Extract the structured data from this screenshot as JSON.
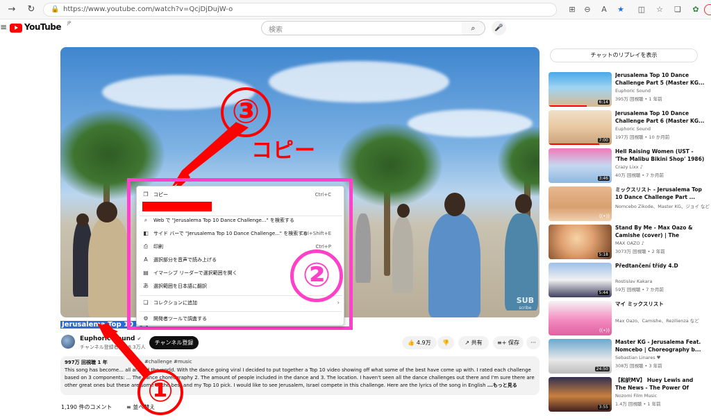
{
  "browser": {
    "url": "https://www.youtube.com/watch?v=QcjDjDujW-o"
  },
  "youtube": {
    "logo_text": "YouTube",
    "region": "JP",
    "search_placeholder": "検索"
  },
  "video": {
    "title": "Jerusalema Top 10 Da",
    "watermark_main": "SUB",
    "watermark_sub": "scribe",
    "channel_name": "Euphoric Sound",
    "channel_subs": "チャンネル登録者数 28.3万人",
    "subscribe_label": "チャンネル登録",
    "likes": "4.9万",
    "share_label": "共有",
    "save_label": "保存",
    "more_label": "···"
  },
  "description": {
    "meta": "997万 回視聴 1 年",
    "tags": "#challenge #music",
    "body": "This song has become... all around the world. With the dance going viral I decided to put together a Top 10 video showing off what some of the best have come up with. I rated each challenge based on 3 components: ... The dance choreography 2. The amount of people included in the dance and 3. The location. I haven't seen all the dance challenges out there and I'm sure there are other great ones but these are some of the best and my Top 10 pick. I would like to see Jerusalem, Israel compete in this challenge. Here are the lyrics of the song in English",
    "more": "...もっと見る"
  },
  "comments": {
    "count": "1,190 件のコメント",
    "sort": "並べ替え"
  },
  "context_menu": {
    "items": [
      {
        "icon": "copy-icon",
        "label": "コピー",
        "shortcut": "Ctrl+C"
      },
      {
        "icon": "search-icon",
        "label": "Web で \"Jerusalema Top 10 Dance Challenge...\" を検索する",
        "shortcut": ""
      },
      {
        "icon": "sidebar-icon",
        "label": "サイド バーで \"Jerusalema Top 10 Dance Challenge...\" を検索する",
        "shortcut": "Ctrl+Shift+E"
      },
      {
        "icon": "print-icon",
        "label": "印刷",
        "shortcut": "Ctrl+P"
      },
      {
        "icon": "read-aloud-icon",
        "label": "選択部分を音声で読み上げる",
        "shortcut": ""
      },
      {
        "icon": "immersive-reader-icon",
        "label": "イマーシブ リーダーで選択範囲を開く",
        "shortcut": ""
      },
      {
        "icon": "translate-icon",
        "label": "選択範囲を日本語に翻訳",
        "shortcut": ""
      },
      {
        "icon": "collection-icon",
        "label": "コレクションに追加",
        "shortcut": ""
      },
      {
        "icon": "devtools-icon",
        "label": "開発者ツールで調査する",
        "shortcut": ""
      }
    ]
  },
  "annotations": {
    "one": "①",
    "two": "②",
    "three": "③",
    "copy_text": "コピー"
  },
  "sidebar": {
    "chat_replay": "チャットのリプレイを表示",
    "videos": [
      {
        "title": "Jerusalema Top 10 Dance Challenge Part 5 (Master KG...",
        "channel": "Euphoric Sound",
        "meta": "395万 回視聴 • 1 年前",
        "duration": "6:14"
      },
      {
        "title": "Jerusalema Top 10 Dance Challenge Part 6 (Master KG...",
        "channel": "Euphoric Sound",
        "meta": "197万 回視聴 • 10 か月前",
        "duration": "7:00"
      },
      {
        "title": "Hell Raising Women (UST - 'The Malibu Bikini Shop' 1986)",
        "channel": "Crazy Lixx ♪",
        "meta": "40万 回視聴 • 7 か月前",
        "duration": "3:46"
      },
      {
        "title": "ミックスリスト - Jerusalema Top 10 Dance Challenge Part ...",
        "channel": "Nomcebo Zikode、Master KG、ジョイ など",
        "meta": "",
        "duration": "((•))"
      },
      {
        "title": "Stand By Me - Max Oazo & Camishe (cover) | The Distanc...",
        "channel": "MAX OAZO ♪",
        "meta": "3073万 回視聴 • 2 年前",
        "duration": "5:18"
      },
      {
        "title": "Předtančení třídy 4.D",
        "channel": "Rostislav Kakara",
        "meta": "59万 回視聴 • 7 か月前",
        "duration": "5:44"
      },
      {
        "title": "マイ ミックスリスト",
        "channel": "Max Oazo、Camishe、Rezilienza など",
        "meta": "",
        "duration": "((•))"
      },
      {
        "title": "Master KG - Jerusalema Feat. Nomcebo | Choreography b...",
        "channel": "Sebastian Linares ♥",
        "meta": "308万 回視聴 • 3 年前",
        "duration": "24:50"
      },
      {
        "title": "【和訳MV】 Huey Lewis and The News - The Power Of Love...",
        "channel": "Nozomi Film Music",
        "meta": "1.4万 回視聴 • 1 年前",
        "duration": "3:55"
      }
    ]
  }
}
